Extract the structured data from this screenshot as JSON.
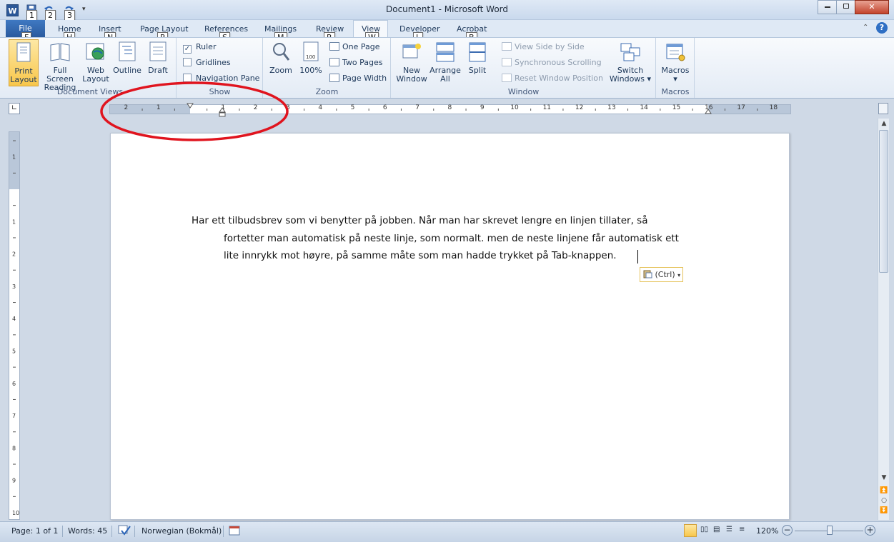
{
  "window": {
    "title": "Document1 - Microsoft Word",
    "app_icon": "W"
  },
  "qat": {
    "keytips": [
      "1",
      "2",
      "3"
    ]
  },
  "tabs": {
    "file": "File",
    "file_key": "F",
    "items": [
      {
        "label": "Home",
        "key": "H"
      },
      {
        "label": "Insert",
        "key": "N"
      },
      {
        "label": "Page Layout",
        "key": "P"
      },
      {
        "label": "References",
        "key": "S"
      },
      {
        "label": "Mailings",
        "key": "M"
      },
      {
        "label": "Review",
        "key": "R"
      },
      {
        "label": "View",
        "key": "W"
      },
      {
        "label": "Developer",
        "key": "L"
      },
      {
        "label": "Acrobat",
        "key": "B"
      }
    ]
  },
  "ribbon": {
    "document_views": {
      "label": "Document Views",
      "print_layout": "Print Layout",
      "print_layout_l1": "Print",
      "print_layout_l2": "Layout",
      "full_screen_l1": "Full Screen",
      "full_screen_l2": "Reading",
      "web_l1": "Web",
      "web_l2": "Layout",
      "outline": "Outline",
      "draft": "Draft"
    },
    "show": {
      "label": "Show",
      "ruler": "Ruler",
      "gridlines": "Gridlines",
      "navigation_pane": "Navigation Pane"
    },
    "zoom": {
      "label": "Zoom",
      "zoom": "Zoom",
      "hundred": "100%",
      "one_page": "One Page",
      "two_pages": "Two Pages",
      "page_width": "Page Width"
    },
    "window": {
      "label": "Window",
      "new_l1": "New",
      "new_l2": "Window",
      "arrange_l1": "Arrange",
      "arrange_l2": "All",
      "split": "Split",
      "view_side": "View Side by Side",
      "sync_scroll": "Synchronous Scrolling",
      "reset_pos": "Reset Window Position",
      "switch_l1": "Switch",
      "switch_l2": "Windows"
    },
    "macros": {
      "label": "Macros",
      "macros": "Macros"
    }
  },
  "ruler": {
    "numbers_left": [
      "2",
      "1"
    ],
    "numbers_right": [
      "1",
      "2",
      "3",
      "4",
      "5",
      "6",
      "7",
      "8",
      "9",
      "10",
      "11",
      "12",
      "13",
      "14",
      "15",
      "16",
      "17",
      "18"
    ]
  },
  "document": {
    "line1": "Har ett tilbudsbrev som vi benytter på jobben. Når man har skrevet lengre en linjen tillater, så",
    "line2": "fortetter man automatisk på neste linje, som normalt. men de neste linjene får automatisk ett",
    "line3": "lite innrykk mot høyre, på samme måte som man hadde trykket på Tab-knappen.",
    "paste_options": "(Ctrl)"
  },
  "status": {
    "page": "Page: 1 of 1",
    "words": "Words: 45",
    "language": "Norwegian (Bokmål)",
    "zoom_level": "120%"
  },
  "colors": {
    "annotation": "#e0141e",
    "ribbon_accent": "#2b5797",
    "selected_button": "#f8c64a"
  }
}
